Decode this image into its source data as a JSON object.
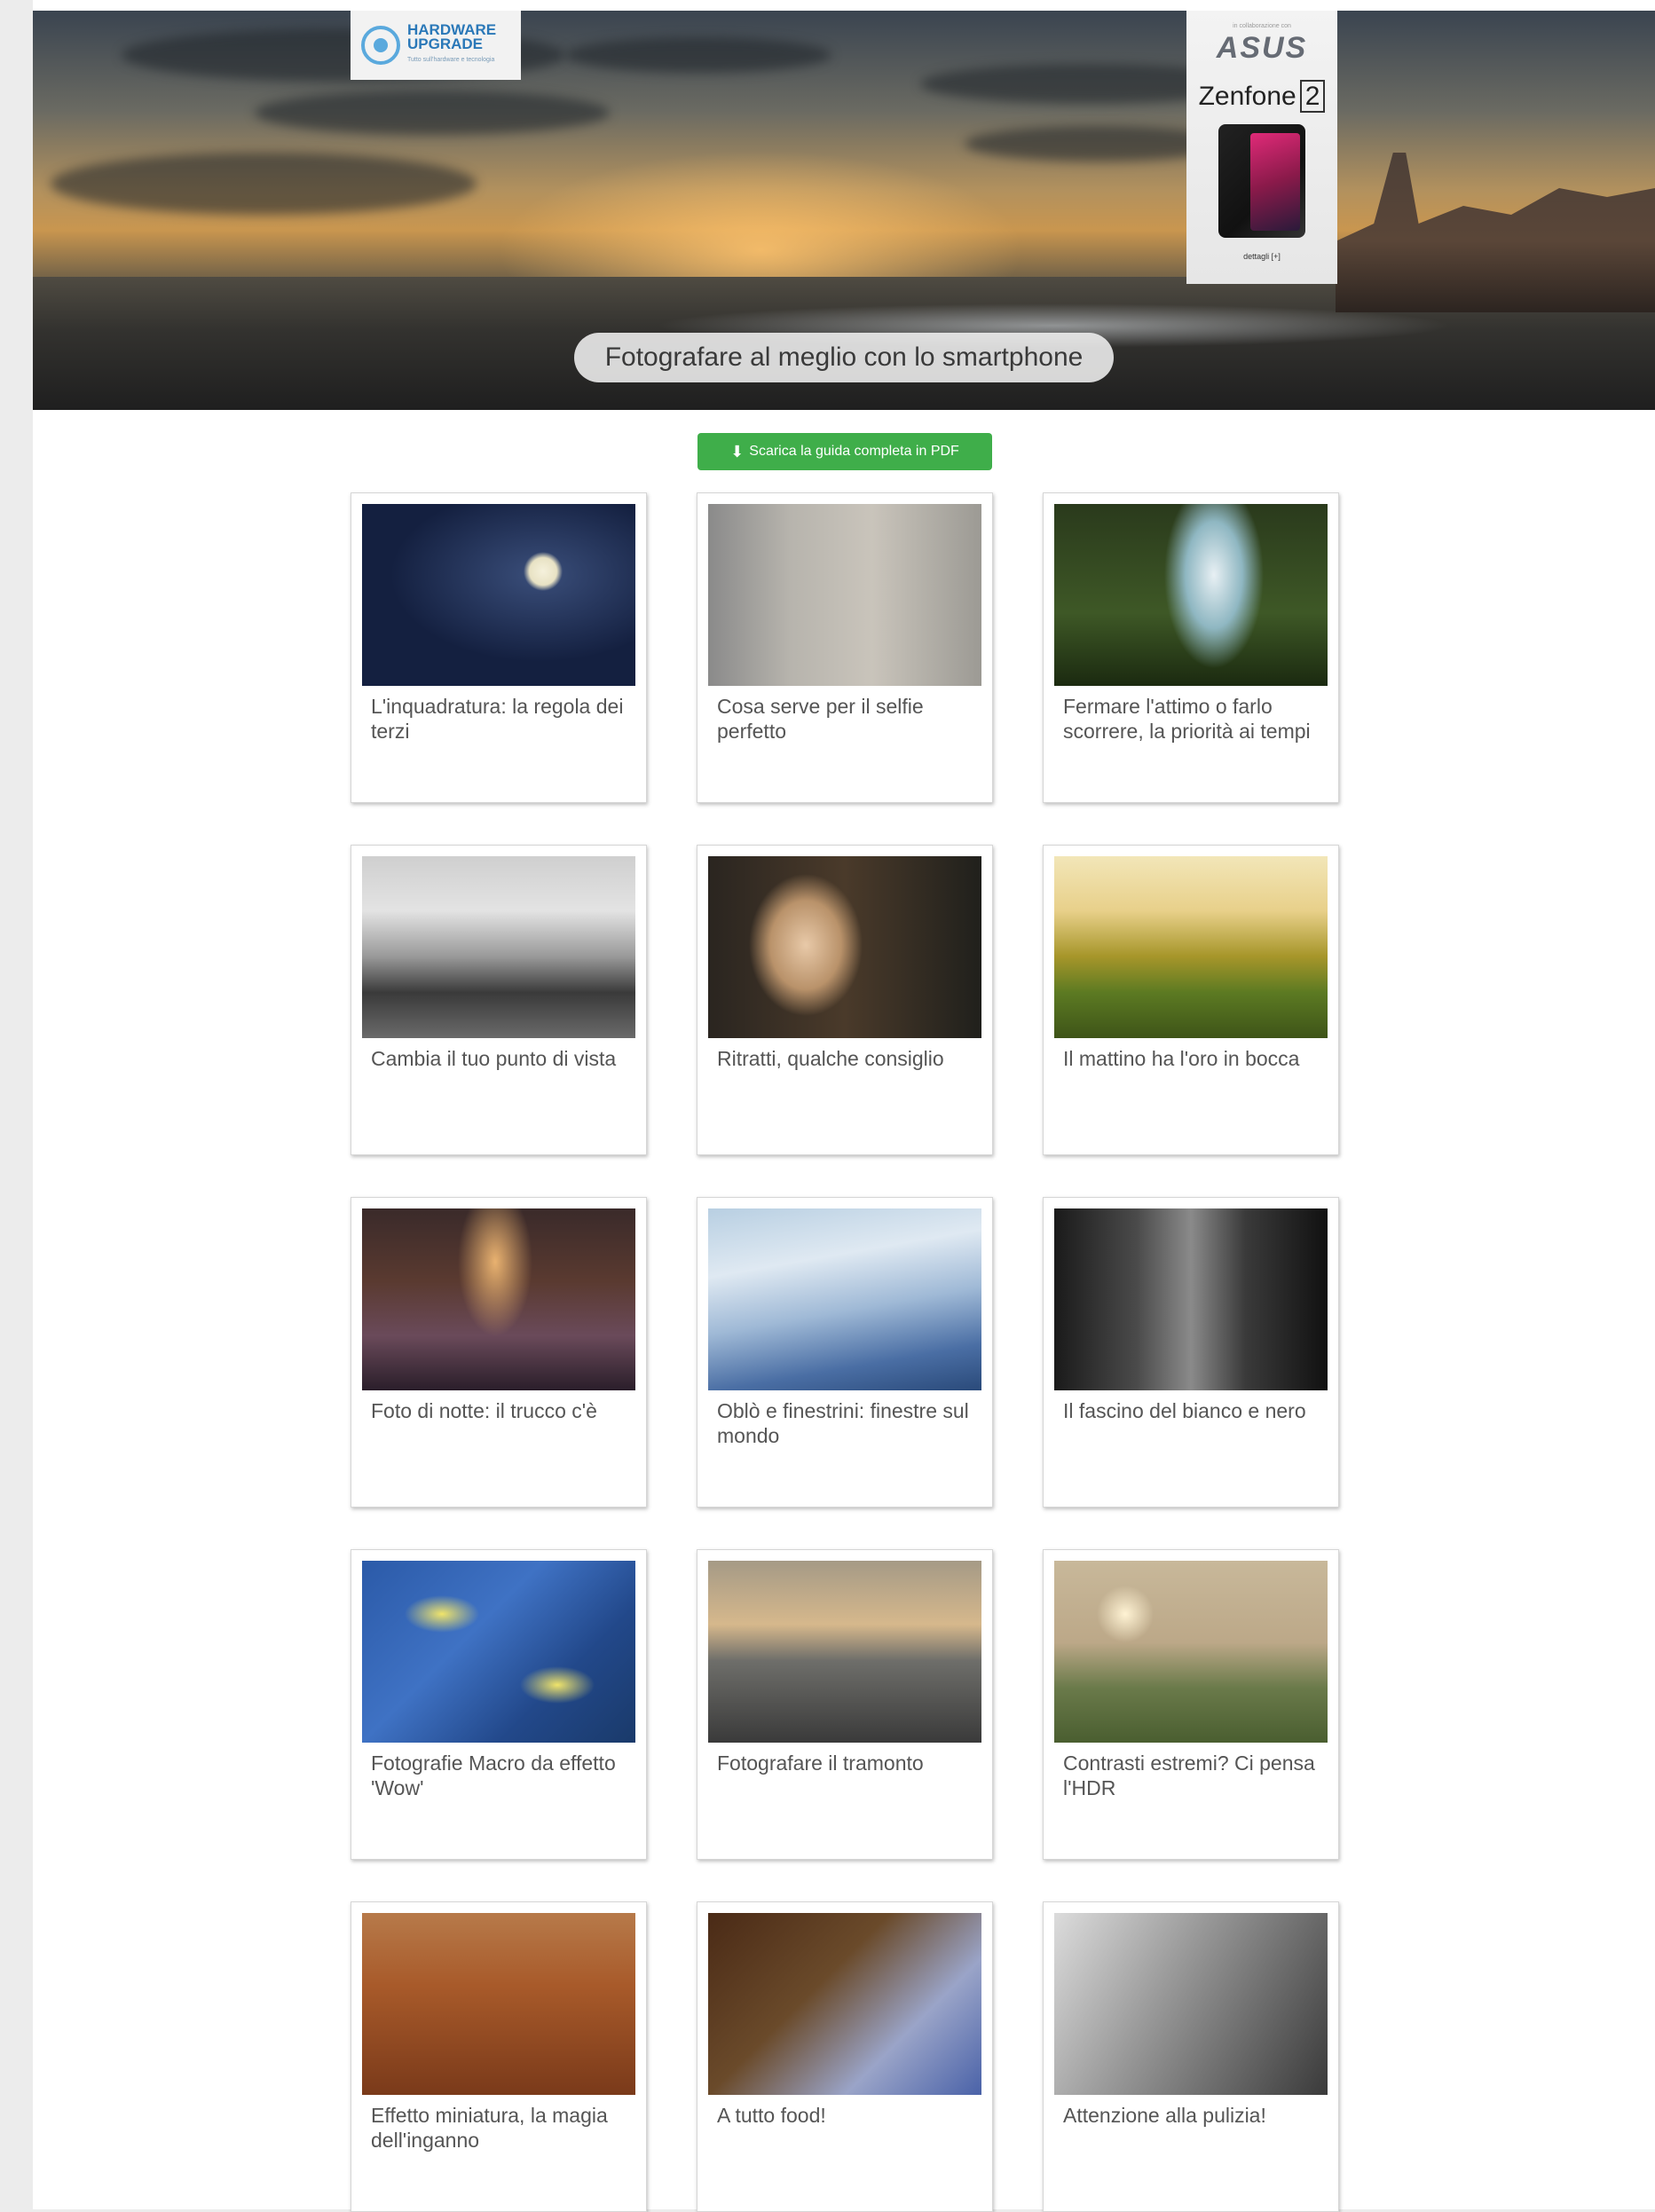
{
  "header": {
    "logo": {
      "line1": "HARDWARE",
      "line2": "UPGRADE",
      "tagline": "Tutto sull'hardware e tecnologia"
    },
    "ad": {
      "tag": "in collaborazione con",
      "brand": "ASUS",
      "model": "Zenfone",
      "model_number": "2",
      "link": "dettagli [+]"
    },
    "title": "Fotografare al meglio con lo smartphone"
  },
  "download_button": {
    "icon": "download-icon",
    "label": "Scarica la guida completa in PDF",
    "color": "#3fae4a"
  },
  "cards": [
    {
      "caption": "L'inquadratura: la regola dei terzi",
      "thumb": "moon-trees"
    },
    {
      "caption": "Cosa serve per il selfie perfetto",
      "thumb": "selfie"
    },
    {
      "caption": "Fermare l'attimo o farlo scorrere, la priorità ai tempi",
      "thumb": "waterfall"
    },
    {
      "caption": "Cambia il tuo punto di vista",
      "thumb": "railway"
    },
    {
      "caption": "Ritratti, qualche consiglio",
      "thumb": "portrait"
    },
    {
      "caption": "Il mattino ha l'oro in bocca",
      "thumb": "meadow"
    },
    {
      "caption": "Foto di notte: il trucco c'è",
      "thumb": "night-street"
    },
    {
      "caption": "Oblò e finestrini: finestre sul mondo",
      "thumb": "airplane-window"
    },
    {
      "caption": "Il fascino del bianco e nero",
      "thumb": "black-white"
    },
    {
      "caption": "Fotografie Macro da effetto 'Wow'",
      "thumb": "macro"
    },
    {
      "caption": "Fotografare il tramonto",
      "thumb": "sunset"
    },
    {
      "caption": "Contrasti estremi? Ci pensa l'HDR",
      "thumb": "hdr-landscape"
    },
    {
      "caption": "Effetto miniatura, la magia dell'inganno",
      "thumb": "city-rooftops"
    },
    {
      "caption": "A tutto food!",
      "thumb": "food"
    },
    {
      "caption": "Attenzione alla pulizia!",
      "thumb": "phone-back"
    }
  ]
}
